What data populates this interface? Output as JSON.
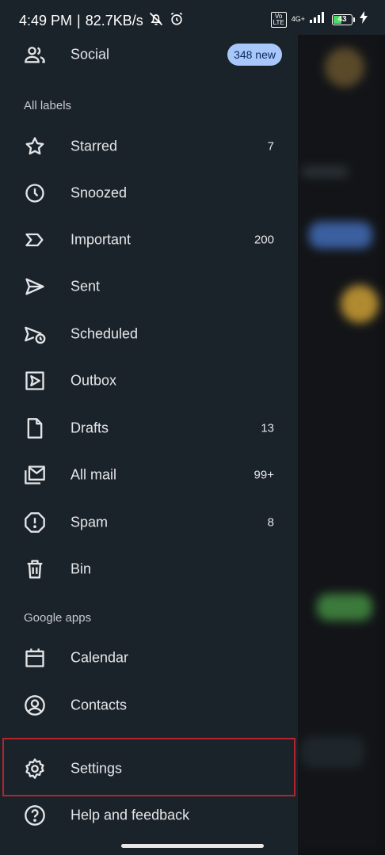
{
  "status_bar": {
    "time": "4:49 PM",
    "separator": "|",
    "net_speed": "82.7KB/s",
    "volte": "Vo\nLTE",
    "network": "4G+",
    "battery": "43"
  },
  "drawer": {
    "social": {
      "label": "Social",
      "badge": "348 new"
    },
    "all_labels_header": "All labels",
    "items": [
      {
        "label": "Starred",
        "count": "7",
        "icon": "star-icon"
      },
      {
        "label": "Snoozed",
        "count": "",
        "icon": "clock-icon"
      },
      {
        "label": "Important",
        "count": "200",
        "icon": "important-icon"
      },
      {
        "label": "Sent",
        "count": "",
        "icon": "send-icon"
      },
      {
        "label": "Scheduled",
        "count": "",
        "icon": "scheduled-send-icon"
      },
      {
        "label": "Outbox",
        "count": "",
        "icon": "outbox-icon"
      },
      {
        "label": "Drafts",
        "count": "13",
        "icon": "draft-icon"
      },
      {
        "label": "All mail",
        "count": "99+",
        "icon": "all-mail-icon"
      },
      {
        "label": "Spam",
        "count": "8",
        "icon": "spam-icon"
      },
      {
        "label": "Bin",
        "count": "",
        "icon": "trash-icon"
      }
    ],
    "google_apps_header": "Google apps",
    "apps": [
      {
        "label": "Calendar",
        "icon": "calendar-icon"
      },
      {
        "label": "Contacts",
        "icon": "contacts-icon"
      }
    ],
    "settings": {
      "label": "Settings",
      "icon": "gear-icon"
    },
    "help": {
      "label": "Help and feedback",
      "icon": "help-icon"
    }
  },
  "colors": {
    "drawer_bg": "#1b232a",
    "badge_bg": "#a8c7fa",
    "highlight_border": "#b3242c"
  }
}
